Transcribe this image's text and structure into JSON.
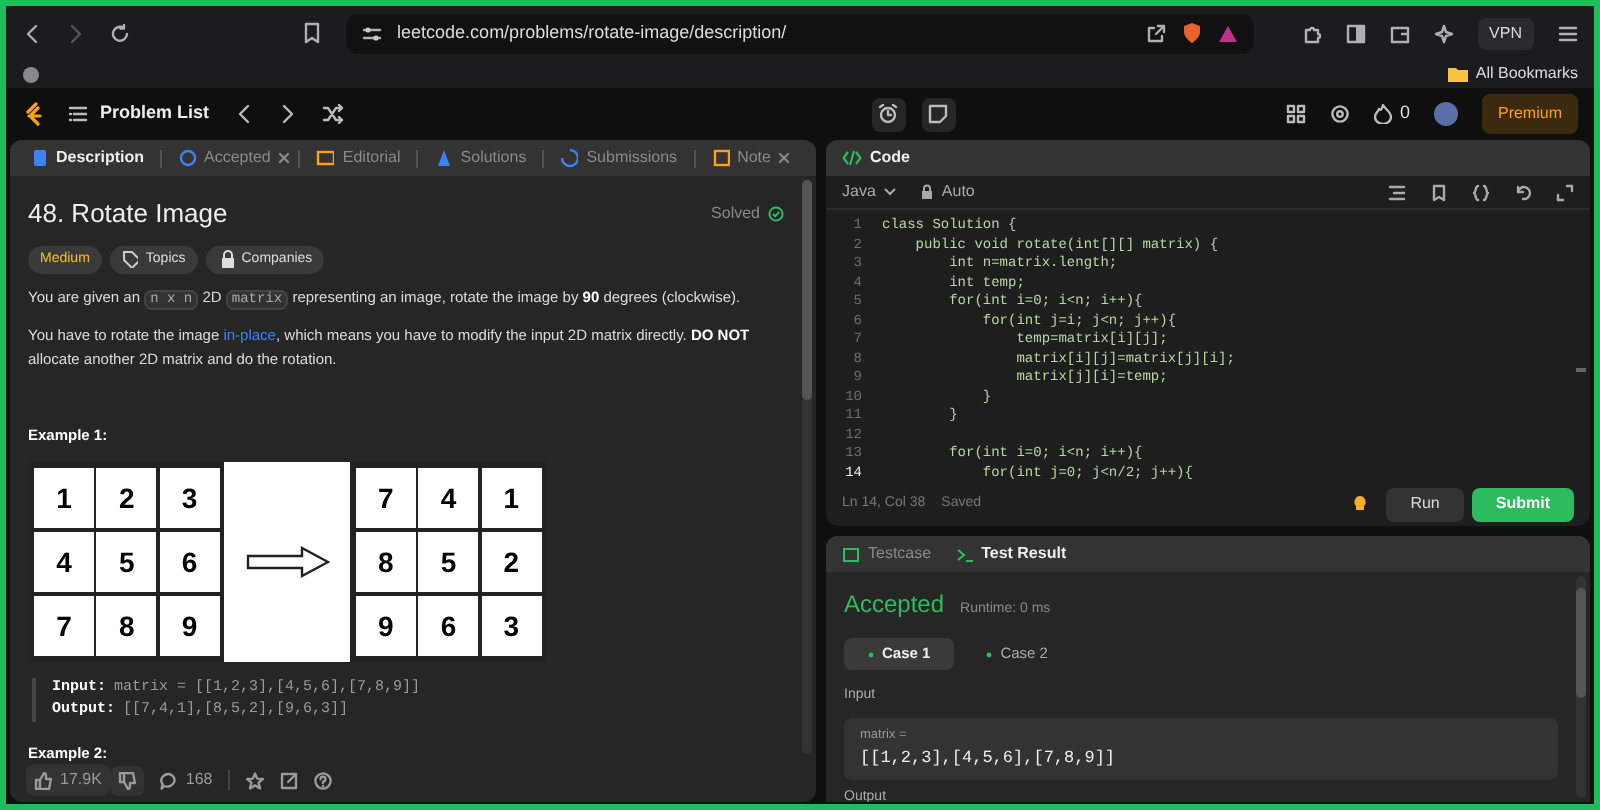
{
  "browser": {
    "url": "leetcode.com/problems/rotate-image/description/",
    "vpn": "VPN",
    "bookmarks": "All Bookmarks"
  },
  "nav": {
    "problem_list": "Problem List",
    "streak": "0",
    "premium": "Premium"
  },
  "left_tabs": [
    {
      "label": "Description",
      "selected": true,
      "closable": false
    },
    {
      "label": "Accepted",
      "selected": false,
      "closable": true
    },
    {
      "label": "Editorial",
      "selected": false,
      "closable": false
    },
    {
      "label": "Solutions",
      "selected": false,
      "closable": false
    },
    {
      "label": "Submissions",
      "selected": false,
      "closable": false
    },
    {
      "label": "Note",
      "selected": false,
      "closable": true
    }
  ],
  "problem": {
    "title": "48. Rotate Image",
    "status": "Solved",
    "difficulty": "Medium",
    "tags": [
      "Topics",
      "Companies"
    ],
    "paragraphs": [
      [
        {
          "kind": "text",
          "text": "You are given an "
        },
        {
          "kind": "code",
          "text": "n x n"
        },
        {
          "kind": "text",
          "text": " 2D "
        },
        {
          "kind": "code",
          "text": "matrix"
        },
        {
          "kind": "text",
          "text": " representing an image, rotate the image by "
        },
        {
          "kind": "bold",
          "text": "90"
        },
        {
          "kind": "text",
          "text": " degrees (clockwise)."
        }
      ],
      [
        {
          "kind": "text",
          "text": "You have to rotate the image "
        },
        {
          "kind": "link",
          "text": "in-place"
        },
        {
          "kind": "text",
          "text": ", which means you have to modify the input 2D matrix directly. "
        },
        {
          "kind": "bold",
          "text": "DO NOT"
        },
        {
          "kind": "text",
          "text": " allocate another 2D matrix and do the rotation."
        }
      ]
    ],
    "example1": {
      "heading": "Example 1:",
      "before": [
        [
          "1",
          "2",
          "3"
        ],
        [
          "4",
          "5",
          "6"
        ],
        [
          "7",
          "8",
          "9"
        ]
      ],
      "after": [
        [
          "7",
          "4",
          "1"
        ],
        [
          "8",
          "5",
          "2"
        ],
        [
          "9",
          "6",
          "3"
        ]
      ],
      "input_label": "Input:",
      "input": "matrix = [[1,2,3],[4,5,6],[7,8,9]]",
      "output_label": "Output:",
      "output": "[[7,4,1],[8,5,2],[9,6,3]]"
    },
    "example2_heading": "Example 2:"
  },
  "footer": {
    "likes": "17.9K",
    "comments": "168"
  },
  "code": {
    "title": "Code",
    "language": "Java",
    "mode": "Auto",
    "lines": [
      {
        "number": "1",
        "text": "class Solution {",
        "current": false
      },
      {
        "number": "2",
        "text": "    public void rotate(int[][] matrix) {",
        "current": false
      },
      {
        "number": "3",
        "text": "        int n=matrix.length;",
        "current": false
      },
      {
        "number": "4",
        "text": "        int temp;",
        "current": false
      },
      {
        "number": "5",
        "text": "        for(int i=0; i<n; i++){",
        "current": false
      },
      {
        "number": "6",
        "text": "            for(int j=i; j<n; j++){",
        "current": false
      },
      {
        "number": "7",
        "text": "                temp=matrix[i][j];",
        "current": false
      },
      {
        "number": "8",
        "text": "                matrix[i][j]=matrix[j][i];",
        "current": false
      },
      {
        "number": "9",
        "text": "                matrix[j][i]=temp;",
        "current": false
      },
      {
        "number": "10",
        "text": "            }",
        "current": false
      },
      {
        "number": "11",
        "text": "        }",
        "current": false
      },
      {
        "number": "12",
        "current": false
      },
      {
        "number": "13",
        "text": "        for(int i=0; i<n; i++){",
        "current": false
      },
      {
        "number": "14",
        "text": "            for(int j=0; j<n/2; j++){",
        "current": true
      }
    ],
    "status": "Ln 14, Col 38",
    "saved": "Saved",
    "run": "Run",
    "submit": "Submit"
  },
  "result": {
    "tabs": [
      {
        "label": "Testcase",
        "selected": false
      },
      {
        "label": "Test Result",
        "selected": true
      }
    ],
    "verdict": "Accepted",
    "runtime": "Runtime: 0 ms",
    "cases": [
      {
        "label": "Case 1",
        "selected": true
      },
      {
        "label": "Case 2",
        "selected": false
      }
    ],
    "input_label": "Input",
    "param": "matrix =",
    "value": "[[1,2,3],[4,5,6],[7,8,9]]",
    "output_label": "Output"
  }
}
